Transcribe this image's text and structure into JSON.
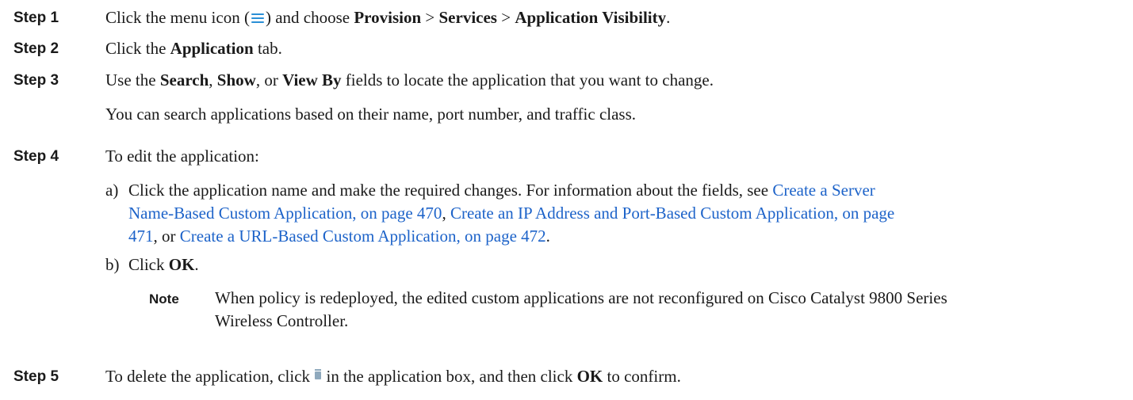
{
  "steps": {
    "s1": {
      "label": "Step 1",
      "t1": "Click the menu icon (",
      "icon": "menu-icon",
      "t2": ") and choose ",
      "b1": "Provision",
      "sep1": " > ",
      "b2": "Services",
      "sep2": " > ",
      "b3": "Application Visibility",
      "t3": "."
    },
    "s2": {
      "label": "Step 2",
      "t1": "Click the ",
      "b1": "Application",
      "t2": " tab."
    },
    "s3": {
      "label": "Step 3",
      "t1": "Use the ",
      "b1": "Search",
      "t2": ", ",
      "b2": "Show",
      "t3": ", or ",
      "b3": "View By",
      "t4": " fields to locate the application that you want to change.",
      "p2": "You can search applications based on their name, port number, and traffic class."
    },
    "s4": {
      "label": "Step 4",
      "intro": "To edit the application:",
      "a_marker": "a)",
      "a_t1": "Click the application name and make the required changes. For information about the fields, see ",
      "link1_a": "Create a Server",
      "link1_b": "Name-Based Custom Application, on page 470",
      "sep1": ", ",
      "link2_a": "Create an IP Address and Port-Based Custom Application, on page",
      "link2_b": "471",
      "sep2": ", or ",
      "link3": "Create a URL-Based Custom Application, on page 472",
      "a_end": ".",
      "b_marker": "b)",
      "b_t1": "Click ",
      "b_b1": "OK",
      "b_end": ".",
      "note_label": "Note",
      "note_line1": "When policy is redeployed, the edited custom applications are not reconfigured on Cisco Catalyst 9800 Series",
      "note_line2": "Wireless Controller."
    },
    "s5": {
      "label": "Step 5",
      "t1": "To delete the application, click ",
      "icon": "trash-icon",
      "t2": " in the application box, and then click ",
      "b1": "OK",
      "t3": " to confirm."
    }
  },
  "colors": {
    "link": "#1d63c9",
    "menu_icon": "#2a8fd6",
    "trash_icon": "#8fa9bd"
  }
}
